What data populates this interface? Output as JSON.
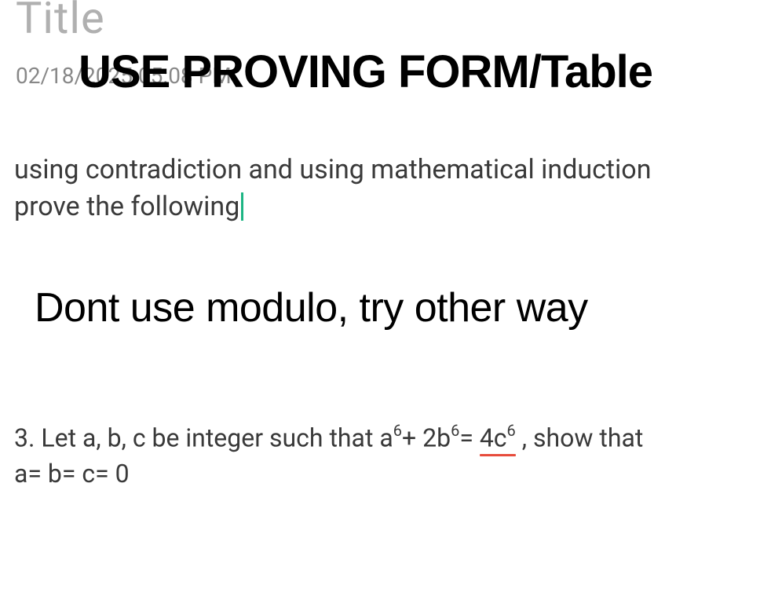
{
  "title_placeholder": "Title",
  "date_text": "02/18/2025 05:08 PM",
  "overlay_header": "USE PROVING FORM/Table",
  "instruction": {
    "line1": "using contradiction and using mathematical induction",
    "line2_part1": "prove the follo",
    "line2_masked": "w",
    "line2_part2": "ing"
  },
  "overlay_note": "Dont use modulo, try other way",
  "problem": {
    "prefix": "3. Let a, b, c be integer such that a",
    "sup1": "6",
    "plus": "+ 2b",
    "sup2": "6",
    "equals": "= ",
    "underlined_text": "4c",
    "sup3": "6",
    "suffix": " , show that",
    "line2": "a= b= c= 0"
  }
}
